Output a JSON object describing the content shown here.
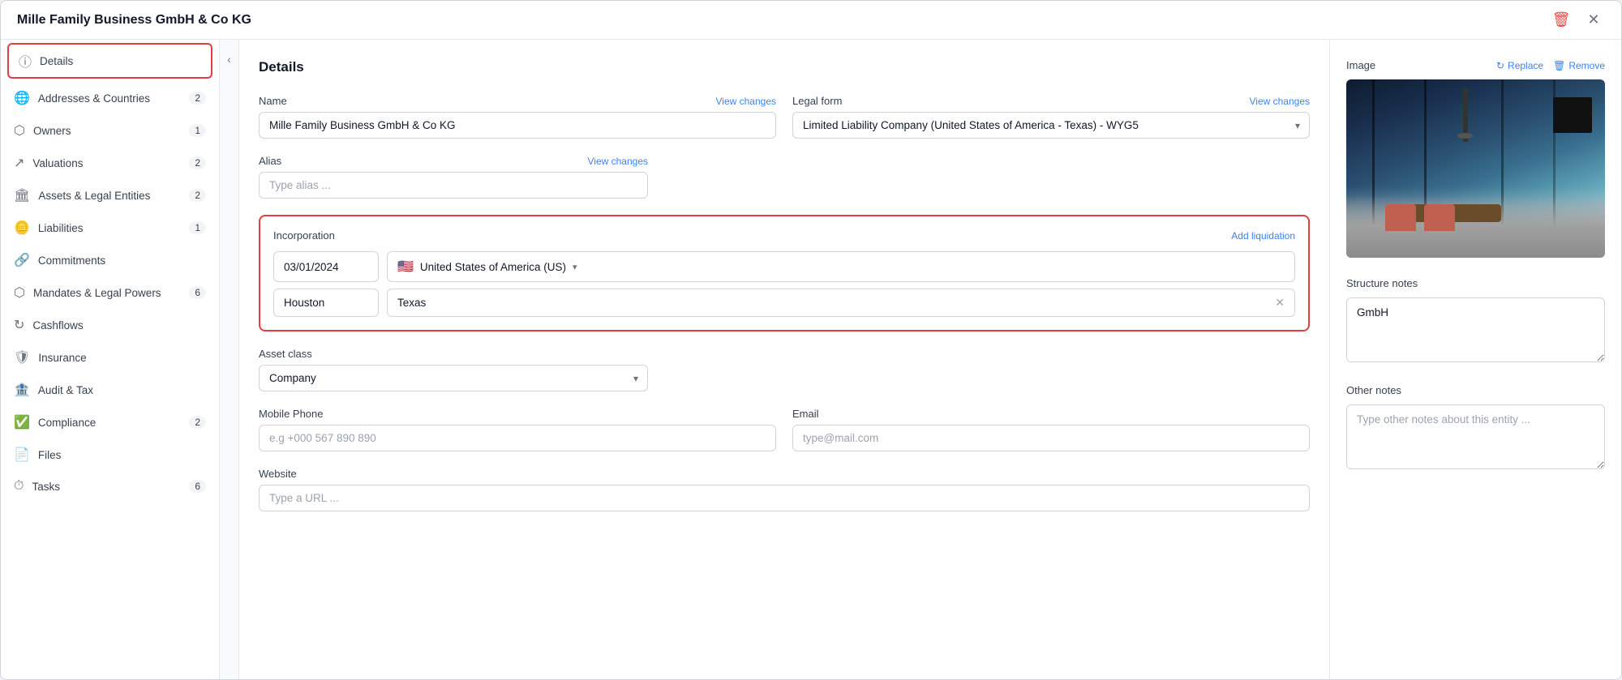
{
  "titleBar": {
    "title": "Mille Family Business GmbH & Co KG",
    "deleteIcon": "🗑",
    "closeIcon": "✕"
  },
  "sidebar": {
    "items": [
      {
        "id": "details",
        "label": "Details",
        "icon": "ⓘ",
        "badge": null,
        "active": true
      },
      {
        "id": "addresses-countries",
        "label": "Addresses & Countries",
        "icon": "🌐",
        "badge": "2",
        "active": false
      },
      {
        "id": "owners",
        "label": "Owners",
        "icon": "⬡",
        "badge": "1",
        "active": false
      },
      {
        "id": "valuations",
        "label": "Valuations",
        "icon": "↗",
        "badge": "2",
        "active": false
      },
      {
        "id": "assets-legal",
        "label": "Assets & Legal Entities",
        "icon": "🏛",
        "badge": "2",
        "active": false
      },
      {
        "id": "liabilities",
        "label": "Liabilities",
        "icon": "🪙",
        "badge": "1",
        "active": false
      },
      {
        "id": "commitments",
        "label": "Commitments",
        "icon": "🔗",
        "badge": null,
        "active": false
      },
      {
        "id": "mandates",
        "label": "Mandates & Legal Powers",
        "icon": "⬡",
        "badge": "6",
        "active": false
      },
      {
        "id": "cashflows",
        "label": "Cashflows",
        "icon": "↻",
        "badge": null,
        "active": false
      },
      {
        "id": "insurance",
        "label": "Insurance",
        "icon": "🛡",
        "badge": null,
        "active": false
      },
      {
        "id": "audit-tax",
        "label": "Audit & Tax",
        "icon": "🏦",
        "badge": null,
        "active": false
      },
      {
        "id": "compliance",
        "label": "Compliance",
        "icon": "✅",
        "badge": "2",
        "active": false
      },
      {
        "id": "files",
        "label": "Files",
        "icon": "📄",
        "badge": null,
        "active": false
      },
      {
        "id": "tasks",
        "label": "Tasks",
        "icon": "⏱",
        "badge": "6",
        "active": false
      }
    ]
  },
  "details": {
    "sectionTitle": "Details",
    "name": {
      "label": "Name",
      "value": "Mille Family Business GmbH & Co KG",
      "viewChanges": "View changes"
    },
    "legalForm": {
      "label": "Legal form",
      "value": "Limited Liability Company (United States of America - Texas) - WYG5",
      "viewChanges": "View changes"
    },
    "alias": {
      "label": "Alias",
      "placeholder": "Type alias ...",
      "viewChanges": "View changes"
    },
    "incorporation": {
      "label": "Incorporation",
      "addLiquidation": "Add liquidation",
      "date": "03/01/2024",
      "country": "United States of America (US)",
      "countryFlag": "🇺🇸",
      "city": "Houston",
      "state": "Texas"
    },
    "assetClass": {
      "label": "Asset class",
      "placeholder": "Company"
    },
    "mobilePhone": {
      "label": "Mobile Phone",
      "placeholder": "e.g +000 567 890 890"
    },
    "email": {
      "label": "Email",
      "placeholder": "type@mail.com"
    },
    "website": {
      "label": "Website",
      "placeholder": "Type a URL ..."
    }
  },
  "rightPanel": {
    "image": {
      "label": "Image",
      "replaceBtn": "Replace",
      "removeBtn": "Remove"
    },
    "structureNotes": {
      "label": "Structure notes",
      "value": "GmbH"
    },
    "otherNotes": {
      "label": "Other notes",
      "placeholder": "Type other notes about this entity ..."
    }
  }
}
